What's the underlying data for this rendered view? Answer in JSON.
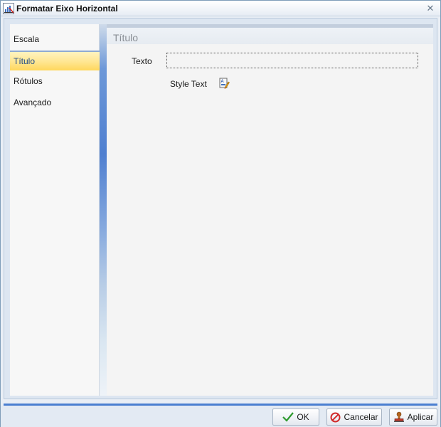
{
  "window": {
    "title": "Formatar Eixo Horizontal"
  },
  "nav": {
    "items": [
      {
        "label": "Escala",
        "selected": false
      },
      {
        "label": "Título",
        "selected": true
      },
      {
        "label": "Rótulos",
        "selected": false
      },
      {
        "label": "Avançado",
        "selected": false
      }
    ]
  },
  "content": {
    "section_title": "Título",
    "text_label": "Texto",
    "text_value": "",
    "style_label": "Style Text"
  },
  "footer": {
    "ok_label": "OK",
    "cancel_label": "Cancelar",
    "apply_label": "Aplicar"
  },
  "icons": {
    "window": "chart-axis-icon",
    "close": "close-icon",
    "style": "style-text-icon",
    "ok": "checkmark-icon",
    "cancel": "cancel-icon",
    "apply": "apply-stamp-icon"
  },
  "colors": {
    "accent": "#4a7fd0",
    "selected_item": "#ffe690",
    "ok_check": "#2e9a2e",
    "cancel_red": "#d12b2b"
  }
}
